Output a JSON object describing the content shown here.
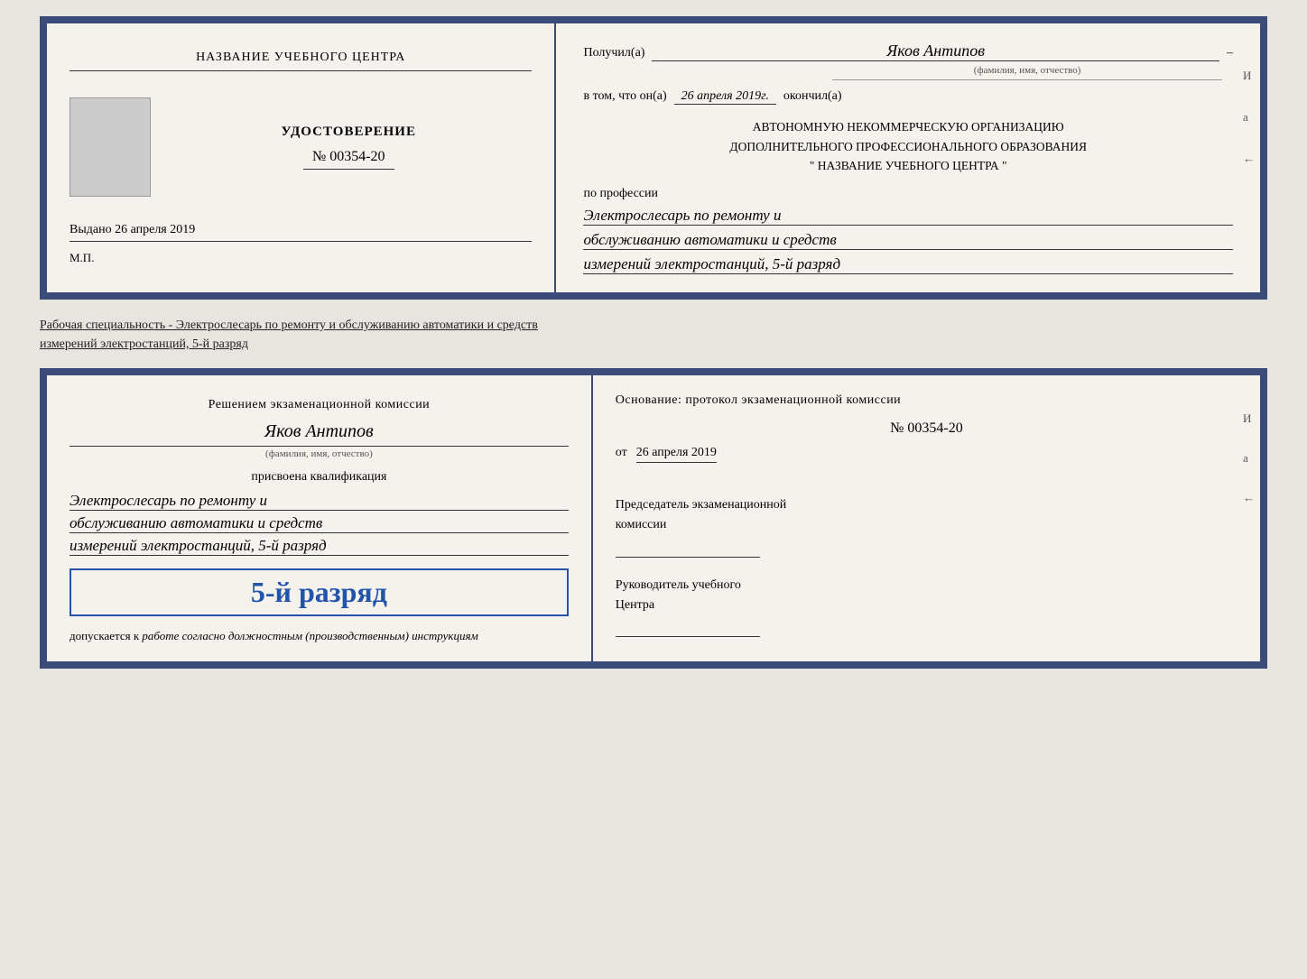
{
  "diploma": {
    "left": {
      "school_name": "НАЗВАНИЕ УЧЕБНОГО ЦЕНТРА",
      "udostoverenie_label": "УДОСТОВЕРЕНИЕ",
      "number": "№ 00354-20",
      "vydano_label": "Выдано",
      "vydano_date": "26 апреля 2019",
      "mp_label": "М.П."
    },
    "right": {
      "poluchil_label": "Получил(а)",
      "recipient_name": "Яков Антипов",
      "fio_sub": "(фамилия, имя, отчество)",
      "vtom_label": "в том, что он(а)",
      "date_okonchill": "26 апреля 2019г.",
      "okonchill_label": "окончил(а)",
      "org_line1": "АВТОНОМНУЮ НЕКОММЕРЧЕСКУЮ ОРГАНИЗАЦИЮ",
      "org_line2": "ДОПОЛНИТЕЛЬНОГО ПРОФЕССИОНАЛЬНОГО ОБРАЗОВАНИЯ",
      "org_line3": "\"  НАЗВАНИЕ УЧЕБНОГО ЦЕНТРА  \"",
      "po_professii": "по профессии",
      "profession_line1": "Электрослесарь по ремонту и",
      "profession_line2": "обслуживанию автоматики и средств",
      "profession_line3": "измерений электростанций, 5-й разряд",
      "side_marks": [
        "И",
        "а",
        "←",
        "–",
        "–",
        "–"
      ]
    }
  },
  "middle_text": {
    "line1": "Рабочая специальность - Электрослесарь по ремонту и обслуживанию автоматики и средств",
    "line2": "измерений электростанций, 5-й разряд"
  },
  "qualification": {
    "left": {
      "resheniem_title": "Решением экзаменационной комиссии",
      "applicant_name": "Яков Антипов",
      "fio_sub": "(фамилия, имя, отчество)",
      "prisvoena_label": "присвоена квалификация",
      "profession_line1": "Электрослесарь по ремонту и",
      "profession_line2": "обслуживанию автоматики и средств",
      "profession_line3": "измерений электростанций, 5-й разряд",
      "razryad_badge": "5-й разряд",
      "dopusk_label": "допускается к",
      "dopusk_italic": "работе согласно должностным (производственным) инструкциям"
    },
    "right": {
      "osnovanie_label": "Основание: протокол экзаменационной комиссии",
      "number_label": "№ 00354-20",
      "ot_label": "от",
      "ot_date": "26 апреля 2019",
      "chairman_label": "Председатель экзаменационной",
      "chairman_label2": "комиссии",
      "ruk_label": "Руководитель учебного",
      "ruk_label2": "Центра",
      "side_marks": [
        "И",
        "а",
        "←",
        "–",
        "–",
        "–",
        "–"
      ]
    }
  }
}
